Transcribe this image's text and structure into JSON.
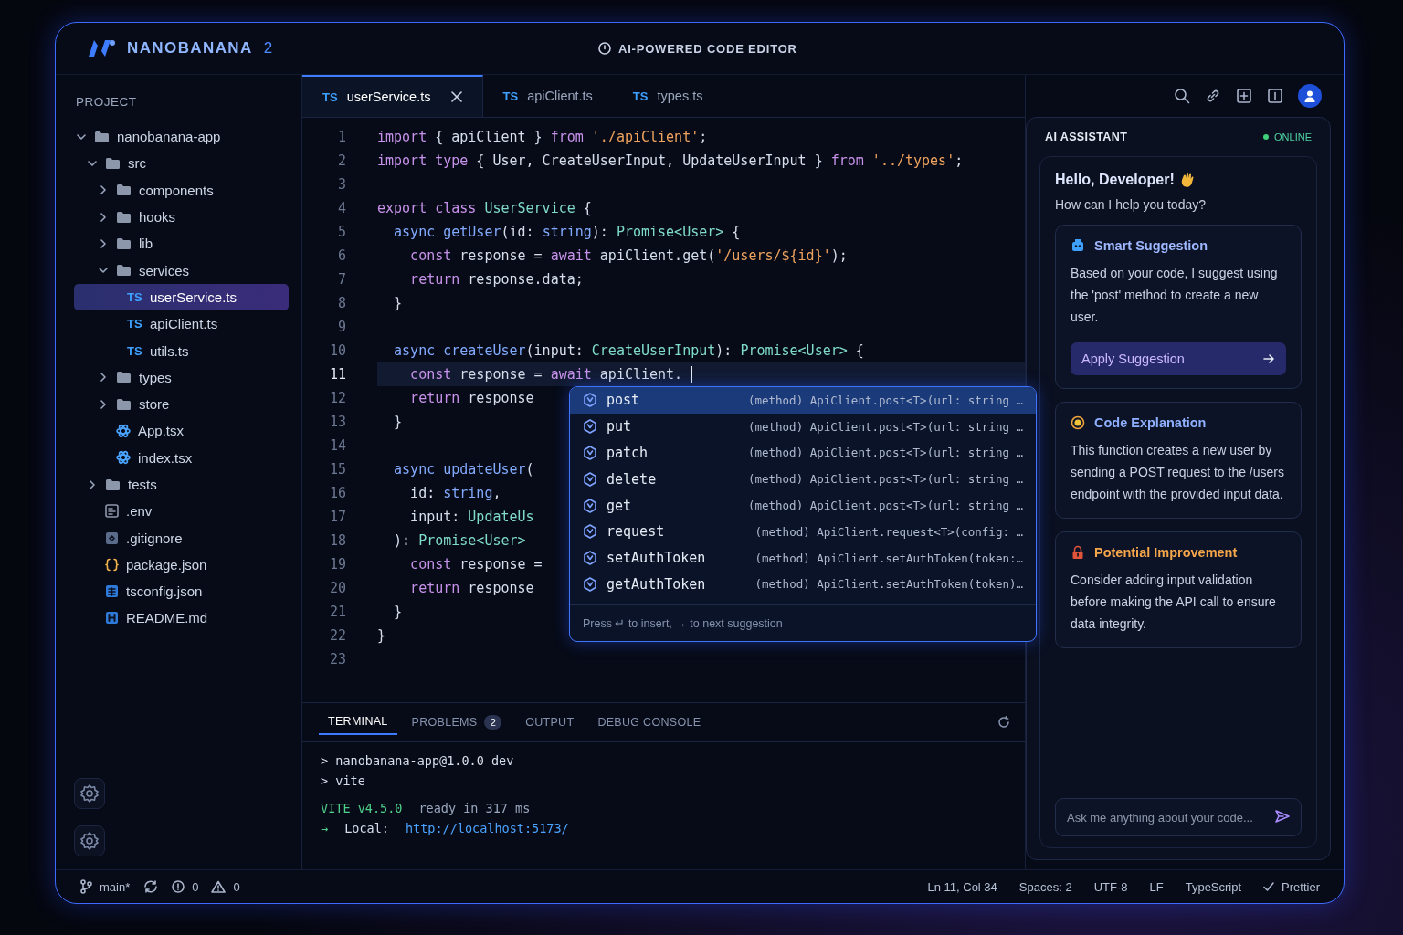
{
  "header": {
    "brand": "NANOBANANA",
    "version": "2",
    "title": "AI-POWERED CODE EDITOR"
  },
  "project": {
    "title": "PROJECT",
    "tree": [
      {
        "name": "nanobanana-app",
        "kind": "folder",
        "expanded": true,
        "selected": false,
        "children": [
          {
            "name": "src",
            "kind": "folder",
            "expanded": true,
            "selected": false,
            "children": [
              {
                "name": "components",
                "kind": "folder",
                "expanded": false,
                "selected": false
              },
              {
                "name": "hooks",
                "kind": "folder",
                "expanded": false,
                "selected": false
              },
              {
                "name": "lib",
                "kind": "folder",
                "expanded": false,
                "selected": false
              },
              {
                "name": "services",
                "kind": "folder",
                "expanded": true,
                "selected": false,
                "children": [
                  {
                    "name": "userService.ts",
                    "kind": "ts",
                    "badge": "TS",
                    "selected": true
                  },
                  {
                    "name": "apiClient.ts",
                    "kind": "ts",
                    "badge": "TS",
                    "selected": false
                  },
                  {
                    "name": "utils.ts",
                    "kind": "ts",
                    "badge": "TS",
                    "selected": false
                  }
                ]
              },
              {
                "name": "types",
                "kind": "folder",
                "expanded": false,
                "selected": false
              },
              {
                "name": "store",
                "kind": "folder",
                "expanded": false,
                "selected": false
              },
              {
                "name": "App.tsx",
                "kind": "react",
                "selected": false
              },
              {
                "name": "index.tsx",
                "kind": "react",
                "selected": false
              }
            ]
          },
          {
            "name": "tests",
            "kind": "folder",
            "expanded": false,
            "selected": false
          },
          {
            "name": ".env",
            "kind": "env",
            "selected": false
          },
          {
            "name": ".gitignore",
            "kind": "git",
            "selected": false
          },
          {
            "name": "package.json",
            "kind": "json",
            "selected": false
          },
          {
            "name": "tsconfig.json",
            "kind": "config",
            "selected": false
          },
          {
            "name": "README.md",
            "kind": "markdown",
            "selected": false
          }
        ]
      }
    ]
  },
  "editor": {
    "tabs": [
      {
        "badge": "TS",
        "label": "userService.ts",
        "selected": true
      },
      {
        "badge": "TS",
        "label": "apiClient.ts",
        "selected": false
      },
      {
        "badge": "TS",
        "label": "types.ts",
        "selected": false
      }
    ],
    "lines": [
      {
        "number": "1",
        "current": false,
        "tokens": [
          {
            "kind": "kw",
            "text": "import"
          },
          {
            "kind": "plain",
            "text": " { apiClient } "
          },
          {
            "kind": "kw",
            "text": "from "
          },
          {
            "kind": "str",
            "text": "'./apiClient'"
          },
          {
            "kind": "plain",
            "text": ";"
          }
        ]
      },
      {
        "number": "2",
        "current": false,
        "tokens": [
          {
            "kind": "kw",
            "text": "import type"
          },
          {
            "kind": "plain",
            "text": " { User, CreateUserInput, UpdateUserInput } "
          },
          {
            "kind": "kw",
            "text": "from "
          },
          {
            "kind": "str",
            "text": "'../types'"
          },
          {
            "kind": "plain",
            "text": ";"
          }
        ]
      },
      {
        "number": "3",
        "current": false
      },
      {
        "number": "4",
        "current": false,
        "tokens": [
          {
            "kind": "kw",
            "text": "export class "
          },
          {
            "kind": "type",
            "text": "UserService"
          },
          {
            "kind": "plain",
            "text": " {"
          }
        ]
      },
      {
        "number": "5",
        "current": false,
        "tokens": [
          {
            "kind": "fn",
            "text": "  async getUser"
          },
          {
            "kind": "plain",
            "text": "(id: "
          },
          {
            "kind": "fn",
            "text": "string"
          },
          {
            "kind": "plain",
            "text": "): "
          },
          {
            "kind": "type",
            "text": "Promise<User>"
          },
          {
            "kind": "plain",
            "text": " {"
          }
        ]
      },
      {
        "number": "6",
        "current": false,
        "tokens": [
          {
            "kind": "kw",
            "text": "    const"
          },
          {
            "kind": "plain",
            "text": " response = "
          },
          {
            "kind": "kw",
            "text": "await"
          },
          {
            "kind": "plain",
            "text": " apiClient.get("
          },
          {
            "kind": "str",
            "text": "'/users/${id}'"
          },
          {
            "kind": "plain",
            "text": ");"
          }
        ]
      },
      {
        "number": "7",
        "current": false,
        "tokens": [
          {
            "kind": "kw",
            "text": "    return"
          },
          {
            "kind": "plain",
            "text": " response.data;"
          }
        ]
      },
      {
        "number": "8",
        "current": false,
        "tokens": [
          {
            "kind": "plain",
            "text": "  }"
          }
        ]
      },
      {
        "number": "9",
        "current": false
      },
      {
        "number": "10",
        "current": false,
        "tokens": [
          {
            "kind": "fn",
            "text": "  async createUser"
          },
          {
            "kind": "plain",
            "text": "(input: "
          },
          {
            "kind": "type",
            "text": "CreateUserInput"
          },
          {
            "kind": "plain",
            "text": "): "
          },
          {
            "kind": "type",
            "text": "Promise<User>"
          },
          {
            "kind": "plain",
            "text": " {"
          }
        ]
      },
      {
        "number": "11",
        "current": true,
        "tokens": [
          {
            "kind": "kw",
            "text": "    const"
          },
          {
            "kind": "plain",
            "text": " response = "
          },
          {
            "kind": "kw",
            "text": "await"
          },
          {
            "kind": "plain",
            "text": " apiClient."
          }
        ]
      },
      {
        "number": "12",
        "current": false,
        "tokens": [
          {
            "kind": "kw",
            "text": "    return"
          },
          {
            "kind": "plain",
            "text": " response"
          }
        ]
      },
      {
        "number": "13",
        "current": false,
        "tokens": [
          {
            "kind": "plain",
            "text": "  }"
          }
        ]
      },
      {
        "number": "14",
        "current": false
      },
      {
        "number": "15",
        "current": false,
        "tokens": [
          {
            "kind": "fn",
            "text": "  async updateUser"
          },
          {
            "kind": "plain",
            "text": "("
          }
        ]
      },
      {
        "number": "16",
        "current": false,
        "tokens": [
          {
            "kind": "plain",
            "text": "    id: "
          },
          {
            "kind": "fn",
            "text": "string"
          },
          {
            "kind": "plain",
            "text": ","
          }
        ]
      },
      {
        "number": "17",
        "current": false,
        "tokens": [
          {
            "kind": "plain",
            "text": "    input: "
          },
          {
            "kind": "type",
            "text": "UpdateUs"
          }
        ]
      },
      {
        "number": "18",
        "current": false,
        "tokens": [
          {
            "kind": "plain",
            "text": "  ): "
          },
          {
            "kind": "type",
            "text": "Promise<User>"
          }
        ]
      },
      {
        "number": "19",
        "current": false,
        "tokens": [
          {
            "kind": "kw",
            "text": "    const"
          },
          {
            "kind": "plain",
            "text": " response ="
          }
        ]
      },
      {
        "number": "20",
        "current": false,
        "tokens": [
          {
            "kind": "kw",
            "text": "    return"
          },
          {
            "kind": "plain",
            "text": " response"
          }
        ]
      },
      {
        "number": "21",
        "current": false,
        "tokens": [
          {
            "kind": "plain",
            "text": "  }"
          }
        ]
      },
      {
        "number": "22",
        "current": false,
        "tokens": [
          {
            "kind": "plain",
            "text": "}"
          }
        ]
      },
      {
        "number": "23",
        "current": false
      }
    ],
    "suggestions": {
      "items": [
        {
          "label": "post",
          "detail": "(method) ApiClient.post<T>(url: string …",
          "selected": true
        },
        {
          "label": "put",
          "detail": "(method) ApiClient.post<T>(url: string …",
          "selected": false
        },
        {
          "label": "patch",
          "detail": "(method) ApiClient.post<T>(url: string …",
          "selected": false
        },
        {
          "label": "delete",
          "detail": "(method) ApiClient.post<T>(url: string …",
          "selected": false
        },
        {
          "label": "get",
          "detail": "(method) ApiClient.post<T>(url: string …",
          "selected": false
        },
        {
          "label": "request",
          "detail": "(method) ApiClient.request<T>(config: …",
          "selected": false
        },
        {
          "label": "setAuthToken",
          "detail": "(method) ApiClient.setAuthToken(token:…",
          "selected": false
        },
        {
          "label": "getAuthToken",
          "detail": "(method) ApiClient.setAuthToken(token)…",
          "selected": false
        }
      ],
      "hint": "Press ↵ to insert, → to next suggestion"
    }
  },
  "terminal": {
    "tabs": [
      {
        "label": "TERMINAL",
        "selected": true
      },
      {
        "label": "PROBLEMS",
        "count": "2",
        "selected": false
      },
      {
        "label": "OUTPUT",
        "selected": false
      },
      {
        "label": "DEBUG CONSOLE",
        "selected": false
      }
    ],
    "lines": [
      {
        "segments": [
          {
            "kind": "plain",
            "text": "> nanobanana-app@1.0.0 dev"
          }
        ]
      },
      {
        "segments": [
          {
            "kind": "plain",
            "text": "> vite"
          }
        ]
      },
      {
        "segments": [
          {
            "kind": "success",
            "text": "VITE v4.5.0"
          },
          {
            "kind": "muted",
            "text": "ready in 317 ms"
          }
        ]
      },
      {
        "segments": [
          {
            "kind": "success",
            "text": "→"
          },
          {
            "kind": "plain",
            "text": "Local:"
          },
          {
            "kind": "link",
            "text": "http://localhost:5173/"
          }
        ]
      }
    ]
  },
  "assistant": {
    "title": "AI ASSISTANT",
    "status": "ONLINE",
    "greeting": "Hello, Developer!",
    "prompt": "How can I help you today?",
    "cards": [
      {
        "kind": "suggestion",
        "title": "Smart Suggestion",
        "body": "Based on your code, I suggest using the 'post' method to create a new user.",
        "action": "Apply Suggestion"
      },
      {
        "kind": "explanation",
        "title": "Code Explanation",
        "body": "This function creates a new user by sending a POST request to the /users endpoint with the provided input data."
      },
      {
        "kind": "improvement",
        "title": "Potential Improvement",
        "body": "Consider adding input validation before making the API call to ensure data integrity."
      }
    ],
    "input": {
      "placeholder": "Ask me anything about your code..."
    }
  },
  "status_bar": {
    "left": [
      {
        "kind": "branch",
        "text": "main*"
      },
      {
        "kind": "sync"
      },
      {
        "kind": "errors",
        "text": "0"
      },
      {
        "kind": "warnings",
        "text": "0"
      }
    ],
    "right": [
      {
        "kind": "text",
        "text": "Ln 11, Col 34"
      },
      {
        "kind": "text",
        "text": "Spaces: 2"
      },
      {
        "kind": "text",
        "text": "UTF-8"
      },
      {
        "kind": "text",
        "text": "LF"
      },
      {
        "kind": "text",
        "text": "TypeScript"
      },
      {
        "kind": "check",
        "text": "Prettier"
      }
    ]
  }
}
